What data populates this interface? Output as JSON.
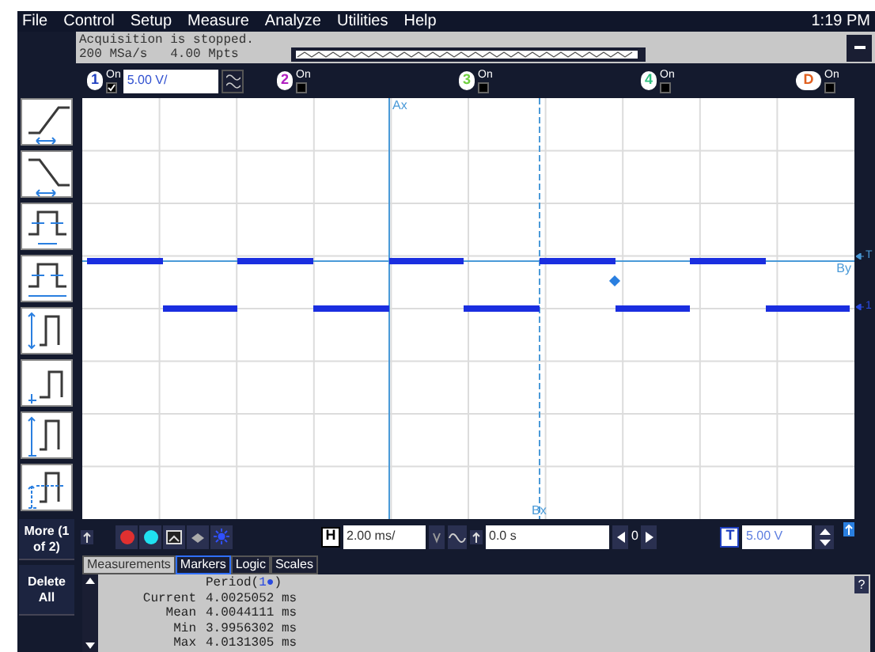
{
  "menu": [
    "File",
    "Control",
    "Setup",
    "Measure",
    "Analyze",
    "Utilities",
    "Help"
  ],
  "clock": "1:19 PM",
  "acquisition": {
    "status": "Acquisition is stopped.",
    "sample_rate": "200 MSa/s",
    "memory_depth": "4.00 Mpts"
  },
  "channels": [
    {
      "label": "1",
      "on_label": "On",
      "on": true,
      "color": "#2040c0",
      "scale": "5.00 V/"
    },
    {
      "label": "2",
      "on_label": "On",
      "on": false,
      "color": "#b020c0"
    },
    {
      "label": "3",
      "on_label": "On",
      "on": false,
      "color": "#70d040"
    },
    {
      "label": "4",
      "on_label": "On",
      "on": false,
      "color": "#30c080"
    },
    {
      "label": "D",
      "on_label": "On",
      "on": false,
      "color": "#e06020"
    }
  ],
  "measure_buttons": [
    {
      "kind": "rise"
    },
    {
      "kind": "fall"
    },
    {
      "kind": "width"
    },
    {
      "kind": "duty"
    },
    {
      "kind": "amplitude"
    },
    {
      "kind": "base"
    },
    {
      "kind": "top"
    },
    {
      "kind": "average"
    }
  ],
  "more_button": "More (1 of 2)",
  "delete_button": "Delete All",
  "markers": {
    "ax": "Ax",
    "bx": "Bx",
    "by": "By",
    "trigger": "T",
    "ground": "1"
  },
  "controls": {
    "horizontal_label": "H",
    "time_scale": "2.00 ms/",
    "delay": "0.0 s",
    "delay_index": "0",
    "trigger_label": "T",
    "trigger_level": "5.00 V"
  },
  "tabs": [
    {
      "label": "Measurements",
      "selected": true,
      "focused": false
    },
    {
      "label": "Markers",
      "selected": false,
      "focused": true
    },
    {
      "label": "Logic",
      "selected": false,
      "focused": false
    },
    {
      "label": "Scales",
      "selected": false,
      "focused": false
    }
  ],
  "measurement": {
    "title_prefix": "Period(",
    "source": "1●",
    "title_suffix": ")",
    "help": "?",
    "rows": [
      {
        "label": "Current",
        "value": "4.0025052 ms"
      },
      {
        "label": "Mean",
        "value": "4.0044111 ms"
      },
      {
        "label": "Min",
        "value": "3.9956302 ms"
      },
      {
        "label": "Max",
        "value": "4.0131305 ms"
      }
    ]
  }
}
